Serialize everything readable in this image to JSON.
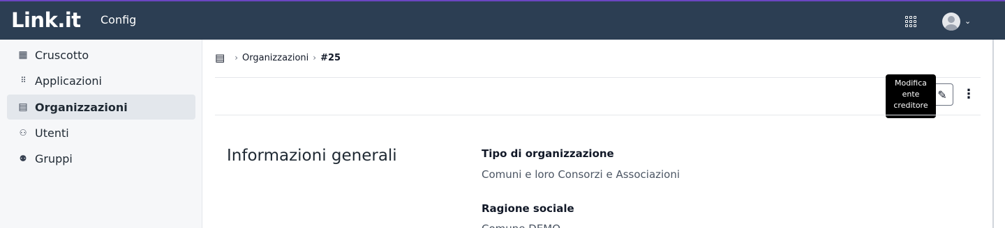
{
  "header": {
    "logo": "Link.it",
    "app_name": "Config",
    "apps_icon": "apps-grid-icon",
    "avatar_icon": "user-avatar-icon",
    "colors": {
      "bar": "#2c3e53",
      "accent": "#6b46c1"
    }
  },
  "sidebar": {
    "items": [
      {
        "label": "Cruscotto",
        "icon": "dashboard-icon",
        "glyph": "▦"
      },
      {
        "label": "Applicazioni",
        "icon": "apps-grid-icon",
        "glyph": "⁞⁞⁞"
      },
      {
        "label": "Organizzazioni",
        "icon": "organization-icon",
        "glyph": "▤"
      },
      {
        "label": "Utenti",
        "icon": "users-icon",
        "glyph": "👥"
      },
      {
        "label": "Gruppi",
        "icon": "groups-icon",
        "glyph": "👥"
      }
    ],
    "active_index": 2
  },
  "breadcrumb": {
    "icon": "organization-icon",
    "items": [
      "Organizzazioni",
      "#25"
    ]
  },
  "toolbar": {
    "edit_icon": "pencil-icon",
    "more_icon": "more-vertical-icon",
    "tooltip_lines": [
      "Modifica",
      "ente",
      "creditore"
    ]
  },
  "section": {
    "title": "Informazioni generali",
    "fields": [
      {
        "label": "Tipo di organizzazione",
        "value": "Comuni e loro Consorzi e Associazioni"
      },
      {
        "label": "Ragione sociale",
        "value": "Comune DEMO"
      }
    ]
  }
}
